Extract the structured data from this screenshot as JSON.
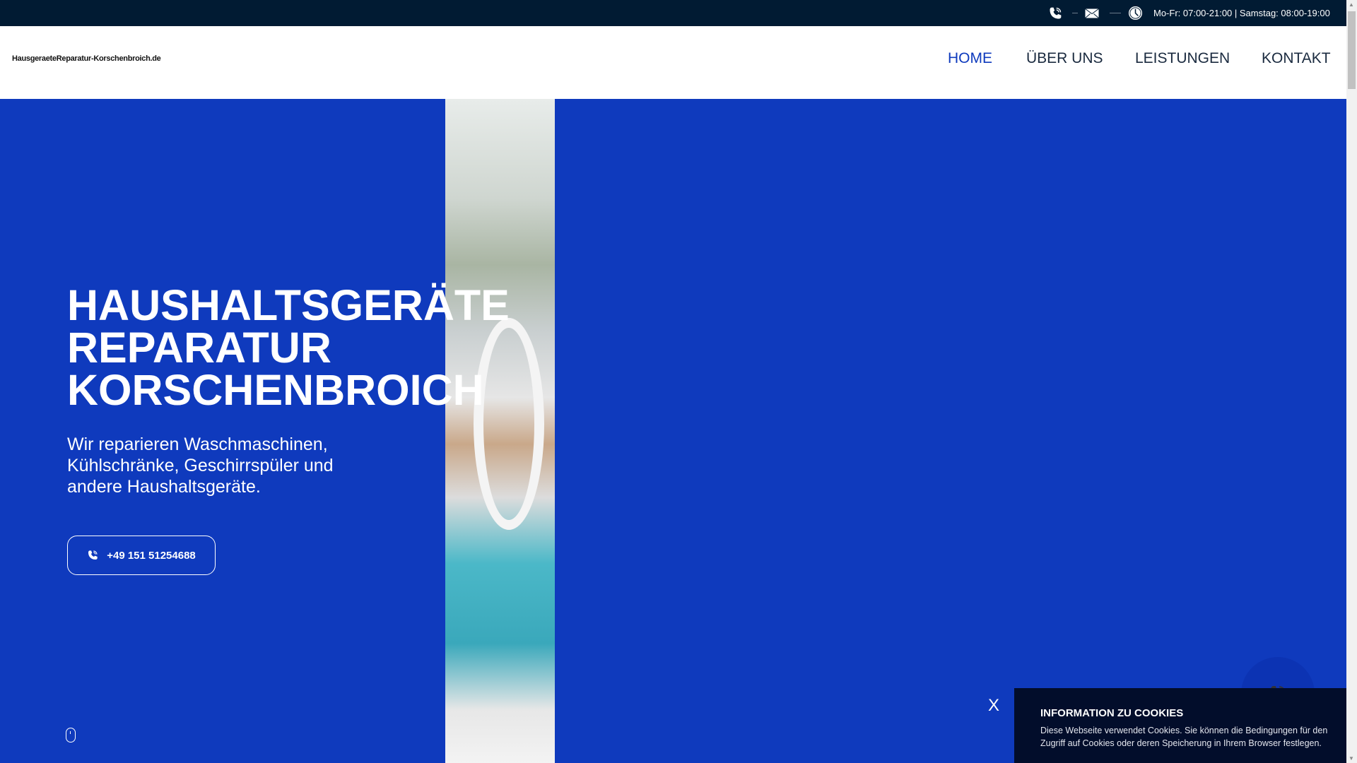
{
  "topbar": {
    "hours": "Mo-Fr: 07:00-21:00 | Samstag: 08:00-19:00"
  },
  "logo": "HausgeraeteReparatur-Korschenbroich.de",
  "nav": [
    {
      "label": "HOME"
    },
    {
      "label": "ÜBER UNS"
    },
    {
      "label": "LEISTUNGEN"
    },
    {
      "label": "KONTAKT"
    }
  ],
  "hero": {
    "title_lines": [
      "HAUSHALTSGERÄTE",
      "REPARATUR",
      "KORSCHENBROICH"
    ],
    "subtitle": "Wir reparieren Waschmaschinen, Kühlschränke, Geschirrspüler und andere Haushaltsgeräte.",
    "phone": "+49 151 51254688"
  },
  "cookie": {
    "close": "X",
    "title": "INFORMATION ZU COOKIES",
    "text": "Diese Webseite verwendet Cookies. Sie können die Bedingungen für den Zugriff auf Cookies oder deren Speicherung in Ihrem Browser festlegen."
  },
  "colors": {
    "brand": "#0f3abd",
    "topbar": "#011b33",
    "cookie": "#020d2b"
  }
}
